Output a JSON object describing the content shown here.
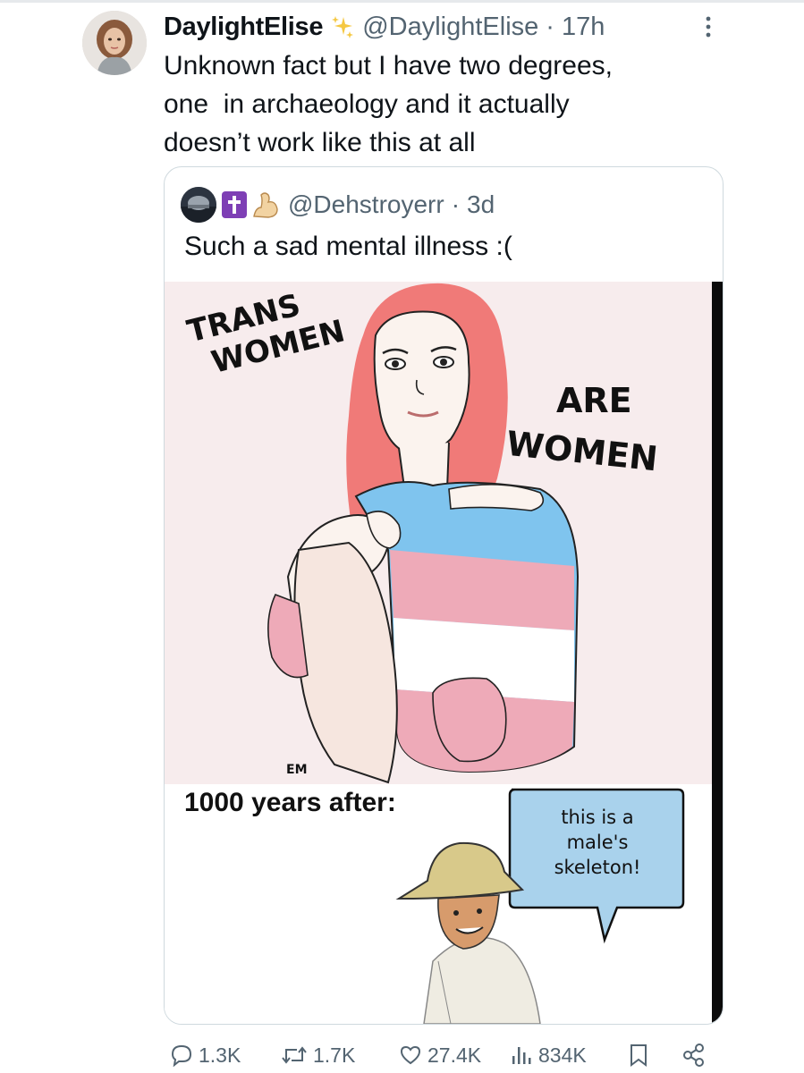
{
  "tweet": {
    "display_name": "DaylightElise",
    "badge_icon": "sparkles-icon",
    "handle": "@DaylightElise",
    "separator": "·",
    "time": "17h",
    "text": "Unknown fact but I have two degrees,\none  in archaeology and it actually\ndoesn’t work like this at all"
  },
  "quote": {
    "handle": "@Dehstroyerr",
    "separator": "·",
    "time": "3d",
    "emoji": [
      "latin-cross-emoji",
      "flexed-biceps-emoji"
    ],
    "text": "Such a sad mental illness :(",
    "meme": {
      "top_left_text_1": "TRANS",
      "top_left_text_2": "WOMEN",
      "right_text_1": "ARE",
      "right_text_2": "WOMEN",
      "signature": "EM",
      "caption": "1000 years after:",
      "speech_line_1": "this is a",
      "speech_line_2": "male's",
      "speech_line_3": "skeleton!"
    }
  },
  "actions": {
    "replies": "1.3K",
    "reposts": "1.7K",
    "likes": "27.4K",
    "views": "834K"
  },
  "colors": {
    "text_primary": "#0f1419",
    "text_secondary": "#536471",
    "border": "#cfd9de",
    "trans_blue": "#7fc4ee",
    "trans_pink": "#eeaab8",
    "hair": "#f07a78",
    "speech_bubble": "#a9d2ec"
  }
}
